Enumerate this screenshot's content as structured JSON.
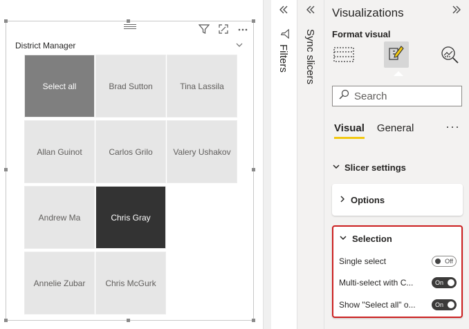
{
  "slicer": {
    "header": "District Manager",
    "tiles": [
      "Select all",
      "Brad Sutton",
      "Tina Lassila",
      "Allan Guinot",
      "Carlos Grilo",
      "Valery Ushakov",
      "Andrew Ma",
      "Chris Gray",
      "Annelie Zubar",
      "Chris McGurk"
    ]
  },
  "panes": {
    "filters_label": "Filters",
    "sync_label": "Sync slicers"
  },
  "viz": {
    "title": "Visualizations",
    "format_label": "Format visual",
    "search_placeholder": "Search",
    "tabs": [
      "Visual",
      "General"
    ],
    "more": "···",
    "section": "Slicer settings",
    "options_card": "Options",
    "selection_card": "Selection",
    "settings": [
      {
        "label": "Single select",
        "state": "Off"
      },
      {
        "label": "Multi-select with C...",
        "state": "On"
      },
      {
        "label": "Show \"Select all\" o...",
        "state": "On"
      }
    ]
  },
  "colors": {
    "accent_tab_underline": "#f2c811",
    "highlight_border": "#cc1f1f",
    "tile_selected": "#333333",
    "tile_select_all": "#7f7f7f"
  }
}
